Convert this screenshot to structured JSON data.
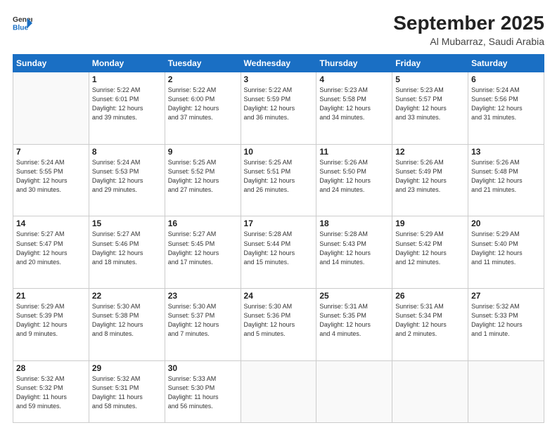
{
  "header": {
    "logo_line1": "General",
    "logo_line2": "Blue",
    "month": "September 2025",
    "location": "Al Mubarraz, Saudi Arabia"
  },
  "weekdays": [
    "Sunday",
    "Monday",
    "Tuesday",
    "Wednesday",
    "Thursday",
    "Friday",
    "Saturday"
  ],
  "weeks": [
    [
      {
        "day": "",
        "info": ""
      },
      {
        "day": "1",
        "info": "Sunrise: 5:22 AM\nSunset: 6:01 PM\nDaylight: 12 hours\nand 39 minutes."
      },
      {
        "day": "2",
        "info": "Sunrise: 5:22 AM\nSunset: 6:00 PM\nDaylight: 12 hours\nand 37 minutes."
      },
      {
        "day": "3",
        "info": "Sunrise: 5:22 AM\nSunset: 5:59 PM\nDaylight: 12 hours\nand 36 minutes."
      },
      {
        "day": "4",
        "info": "Sunrise: 5:23 AM\nSunset: 5:58 PM\nDaylight: 12 hours\nand 34 minutes."
      },
      {
        "day": "5",
        "info": "Sunrise: 5:23 AM\nSunset: 5:57 PM\nDaylight: 12 hours\nand 33 minutes."
      },
      {
        "day": "6",
        "info": "Sunrise: 5:24 AM\nSunset: 5:56 PM\nDaylight: 12 hours\nand 31 minutes."
      }
    ],
    [
      {
        "day": "7",
        "info": "Sunrise: 5:24 AM\nSunset: 5:55 PM\nDaylight: 12 hours\nand 30 minutes."
      },
      {
        "day": "8",
        "info": "Sunrise: 5:24 AM\nSunset: 5:53 PM\nDaylight: 12 hours\nand 29 minutes."
      },
      {
        "day": "9",
        "info": "Sunrise: 5:25 AM\nSunset: 5:52 PM\nDaylight: 12 hours\nand 27 minutes."
      },
      {
        "day": "10",
        "info": "Sunrise: 5:25 AM\nSunset: 5:51 PM\nDaylight: 12 hours\nand 26 minutes."
      },
      {
        "day": "11",
        "info": "Sunrise: 5:26 AM\nSunset: 5:50 PM\nDaylight: 12 hours\nand 24 minutes."
      },
      {
        "day": "12",
        "info": "Sunrise: 5:26 AM\nSunset: 5:49 PM\nDaylight: 12 hours\nand 23 minutes."
      },
      {
        "day": "13",
        "info": "Sunrise: 5:26 AM\nSunset: 5:48 PM\nDaylight: 12 hours\nand 21 minutes."
      }
    ],
    [
      {
        "day": "14",
        "info": "Sunrise: 5:27 AM\nSunset: 5:47 PM\nDaylight: 12 hours\nand 20 minutes."
      },
      {
        "day": "15",
        "info": "Sunrise: 5:27 AM\nSunset: 5:46 PM\nDaylight: 12 hours\nand 18 minutes."
      },
      {
        "day": "16",
        "info": "Sunrise: 5:27 AM\nSunset: 5:45 PM\nDaylight: 12 hours\nand 17 minutes."
      },
      {
        "day": "17",
        "info": "Sunrise: 5:28 AM\nSunset: 5:44 PM\nDaylight: 12 hours\nand 15 minutes."
      },
      {
        "day": "18",
        "info": "Sunrise: 5:28 AM\nSunset: 5:43 PM\nDaylight: 12 hours\nand 14 minutes."
      },
      {
        "day": "19",
        "info": "Sunrise: 5:29 AM\nSunset: 5:42 PM\nDaylight: 12 hours\nand 12 minutes."
      },
      {
        "day": "20",
        "info": "Sunrise: 5:29 AM\nSunset: 5:40 PM\nDaylight: 12 hours\nand 11 minutes."
      }
    ],
    [
      {
        "day": "21",
        "info": "Sunrise: 5:29 AM\nSunset: 5:39 PM\nDaylight: 12 hours\nand 9 minutes."
      },
      {
        "day": "22",
        "info": "Sunrise: 5:30 AM\nSunset: 5:38 PM\nDaylight: 12 hours\nand 8 minutes."
      },
      {
        "day": "23",
        "info": "Sunrise: 5:30 AM\nSunset: 5:37 PM\nDaylight: 12 hours\nand 7 minutes."
      },
      {
        "day": "24",
        "info": "Sunrise: 5:30 AM\nSunset: 5:36 PM\nDaylight: 12 hours\nand 5 minutes."
      },
      {
        "day": "25",
        "info": "Sunrise: 5:31 AM\nSunset: 5:35 PM\nDaylight: 12 hours\nand 4 minutes."
      },
      {
        "day": "26",
        "info": "Sunrise: 5:31 AM\nSunset: 5:34 PM\nDaylight: 12 hours\nand 2 minutes."
      },
      {
        "day": "27",
        "info": "Sunrise: 5:32 AM\nSunset: 5:33 PM\nDaylight: 12 hours\nand 1 minute."
      }
    ],
    [
      {
        "day": "28",
        "info": "Sunrise: 5:32 AM\nSunset: 5:32 PM\nDaylight: 11 hours\nand 59 minutes."
      },
      {
        "day": "29",
        "info": "Sunrise: 5:32 AM\nSunset: 5:31 PM\nDaylight: 11 hours\nand 58 minutes."
      },
      {
        "day": "30",
        "info": "Sunrise: 5:33 AM\nSunset: 5:30 PM\nDaylight: 11 hours\nand 56 minutes."
      },
      {
        "day": "",
        "info": ""
      },
      {
        "day": "",
        "info": ""
      },
      {
        "day": "",
        "info": ""
      },
      {
        "day": "",
        "info": ""
      }
    ]
  ]
}
